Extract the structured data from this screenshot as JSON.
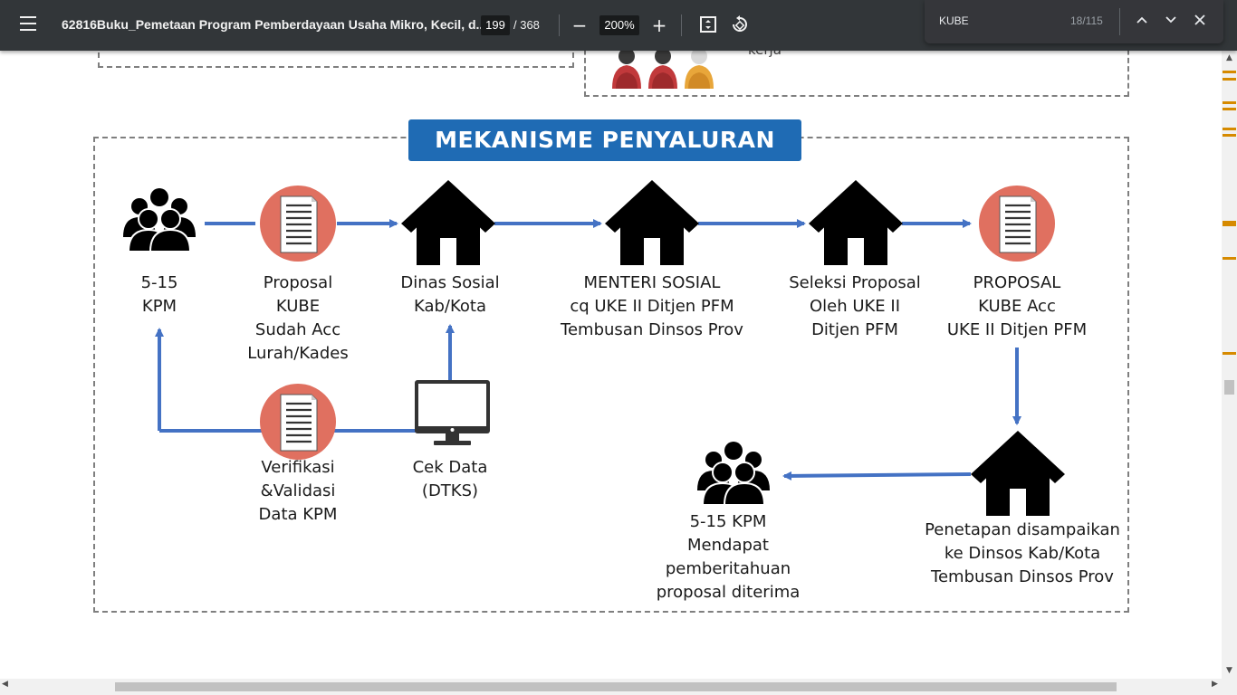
{
  "toolbar": {
    "title": "62816Buku_Pemetaan Program Pemberdayaan Usaha Mikro, Kecil, d...",
    "page_current": "199",
    "page_total": "/ 368",
    "zoom": "200%",
    "zoom_out_icon": "minus-icon",
    "zoom_in_icon": "plus-icon",
    "fit_icon": "fit-page-icon",
    "rotate_icon": "rotate-icon"
  },
  "find": {
    "query": "KUBE",
    "count": "18/115"
  },
  "document": {
    "top_partial_text": "kerja",
    "heading": "MEKANISME PENYALURAN",
    "nodes": {
      "kpm_start": "5-15\nKPM",
      "proposal": "Proposal\nKUBE\nSudah Acc\nLurah/Kades",
      "dinsos": "Dinas Sosial\nKab/Kota",
      "menteri": "MENTERI SOSIAL\ncq UKE II Ditjen PFM\nTembusan Dinsos Prov",
      "seleksi": "Seleksi Proposal\nOleh UKE II\nDitjen PFM",
      "proposal_acc": "PROPOSAL\nKUBE Acc\nUKE II Ditjen PFM",
      "penetapan": "Penetapan disampaikan\nke Dinsos Kab/Kota\nTembusan Dinsos Prov",
      "kpm_end": "5-15 KPM\nMendapat\npemberitahuan\nproposal diterima",
      "verifikasi": "Verifikasi\n&Validasi\nData KPM",
      "cek_data": "Cek Data\n(DTKS)"
    },
    "colors": {
      "heading_bg": "#1f6bb4",
      "arrow": "#4472c4",
      "doc_circle": "#e07060",
      "icon": "#000000"
    }
  }
}
